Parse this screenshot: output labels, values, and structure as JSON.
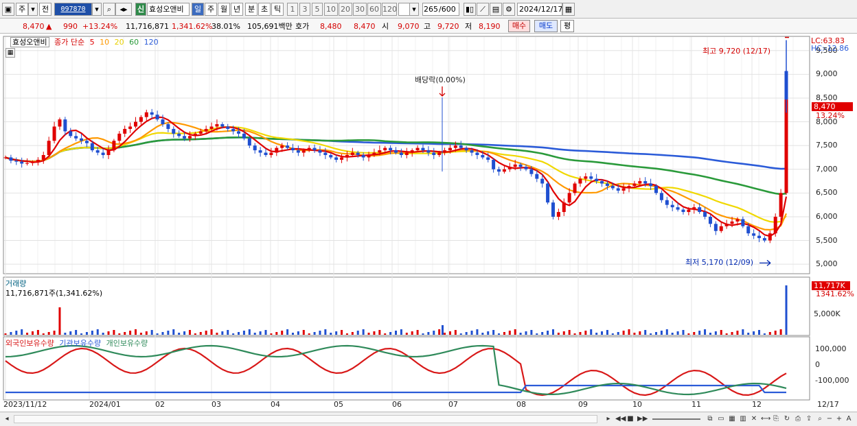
{
  "toolbar": {
    "period_main": "주",
    "prev_label": "전",
    "code": "097870",
    "market_badge": "신",
    "name": "효성오앤비",
    "periods": [
      "일",
      "주",
      "월",
      "년",
      "분",
      "초",
      "틱"
    ],
    "active_period": "일",
    "intervals": [
      "1",
      "3",
      "5",
      "10",
      "20",
      "30",
      "60",
      "120"
    ],
    "count": "265",
    "count_total": "/600",
    "date": "2024/12/17"
  },
  "quote": {
    "price": "8,470",
    "change_arrow": "▲",
    "change": "990",
    "change_pct": "+13.24%",
    "volume": "11,716,871",
    "volume_ratio": "1,341.62%",
    "turnover": "38.01%",
    "amount": "105,691백만",
    "hoga_label": "호가",
    "hoga_bid": "8,480",
    "hoga_ask": "8,470",
    "open_label": "시",
    "open": "9,070",
    "high_label": "고",
    "high": "9,720",
    "low_label": "저",
    "low": "8,190",
    "buy_button": "매수",
    "sell_button": "매도",
    "eval_button": "평"
  },
  "price_panel": {
    "legend_name": "효성오앤비",
    "legend_series": "종가 단순",
    "ma_periods": [
      "5",
      "10",
      "20",
      "60",
      "120"
    ],
    "ma_colors": [
      "#e00000",
      "#ff9900",
      "#f0d800",
      "#2a9a3a",
      "#2b5bd8"
    ],
    "y_ticks": [
      "9,500",
      "9,000",
      "8,500",
      "8,000",
      "7,500",
      "7,000",
      "6,500",
      "6,000",
      "5,500",
      "5,000"
    ],
    "lc": "LC:63.83",
    "hc": "HC:-12.86",
    "last_price": "8,470",
    "last_pct": "13.24%",
    "high_note": "최고 9,720 (12/17)",
    "low_note": "최저 5,170 (12/09)",
    "dividend_note": "배당락(0.00%)"
  },
  "volume_panel": {
    "title": "거래량",
    "value": "11,716,871주(1,341.62%)",
    "y_tick": "5,000K",
    "last_box": "11,717K",
    "last_pct": "1341.62%"
  },
  "holding_panel": {
    "legend": [
      "외국인보유수량",
      "기관보유수량",
      "개인보유수량"
    ],
    "colors": [
      "#d81818",
      "#2b5bd8",
      "#2f8a5a"
    ],
    "y_ticks": [
      "100,000",
      "0",
      "-100,000"
    ]
  },
  "x_axis": {
    "labels": [
      "2023/11/12",
      "2024/01",
      "02",
      "03",
      "04",
      "05",
      "06",
      "07",
      "08",
      "09",
      "10",
      "11",
      "12"
    ],
    "right_label": "12/17"
  },
  "chart_data": {
    "type": "candlestick",
    "close": [
      7250,
      7180,
      7160,
      7120,
      7130,
      7150,
      7200,
      7300,
      7600,
      7900,
      8050,
      7800,
      7700,
      7650,
      7600,
      7550,
      7400,
      7350,
      7300,
      7400,
      7600,
      7750,
      7850,
      7900,
      8000,
      8100,
      8200,
      8150,
      8050,
      7950,
      7850,
      7750,
      7700,
      7650,
      7700,
      7750,
      7800,
      7850,
      7900,
      7950,
      7900,
      7850,
      7800,
      7750,
      7650,
      7500,
      7400,
      7350,
      7300,
      7350,
      7450,
      7500,
      7450,
      7400,
      7350,
      7400,
      7450,
      7400,
      7350,
      7300,
      7250,
      7200,
      7250,
      7300,
      7350,
      7300,
      7250,
      7300,
      7350,
      7400,
      7450,
      7400,
      7350,
      7300,
      7350,
      7400,
      7450,
      7400,
      7350,
      7300,
      7350,
      7400,
      7450,
      7500,
      7450,
      7400,
      7350,
      7300,
      7250,
      7200,
      7000,
      6950,
      7000,
      7050,
      7100,
      7050,
      7000,
      6900,
      6800,
      6700,
      6300,
      6000,
      6100,
      6300,
      6500,
      6700,
      6800,
      6850,
      6800,
      6750,
      6700,
      6650,
      6600,
      6550,
      6600,
      6650,
      6700,
      6750,
      6700,
      6650,
      6500,
      6350,
      6250,
      6200,
      6150,
      6100,
      6150,
      6200,
      6100,
      6000,
      5850,
      5700,
      5800,
      5850,
      5900,
      5950,
      5800,
      5650,
      5600,
      5550,
      5500,
      5650,
      6000,
      6500,
      8470
    ],
    "high_point": {
      "date": "12/17",
      "value": 9720
    },
    "low_point": {
      "date": "12/09",
      "value": 5170
    },
    "ylim": [
      5000,
      9500
    ]
  }
}
